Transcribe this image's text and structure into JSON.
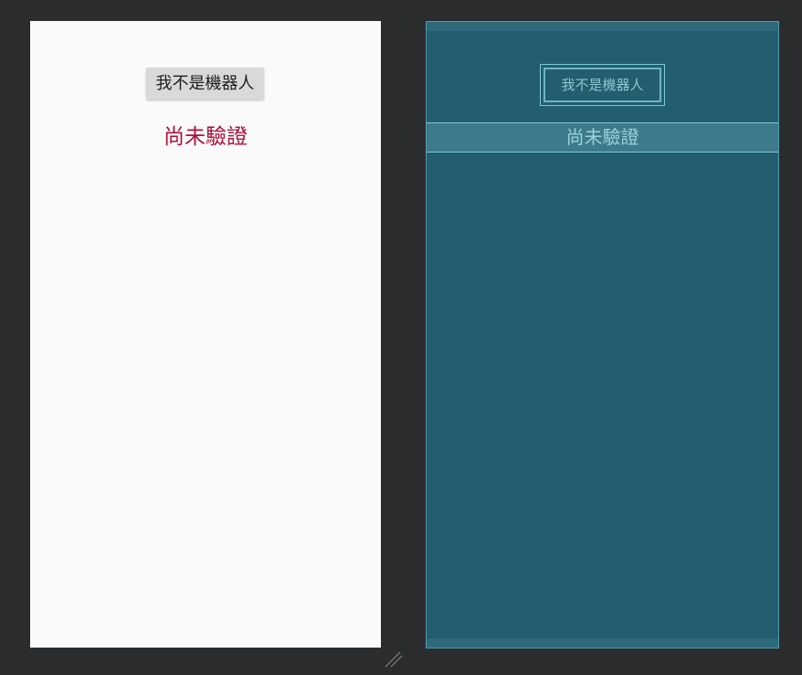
{
  "design_preview": {
    "button_label": "我不是機器人",
    "status_text": "尚未驗證",
    "status_color": "#a8113a",
    "background_color": "#fafafa"
  },
  "blueprint_preview": {
    "button_label": "我不是機器人",
    "status_text": "尚未驗證",
    "background_color": "#245d6f",
    "outline_color": "#7cc9d9"
  },
  "editor": {
    "background_color": "#2b2c2e",
    "resize_handle_icon": "resize-handle-icon"
  }
}
